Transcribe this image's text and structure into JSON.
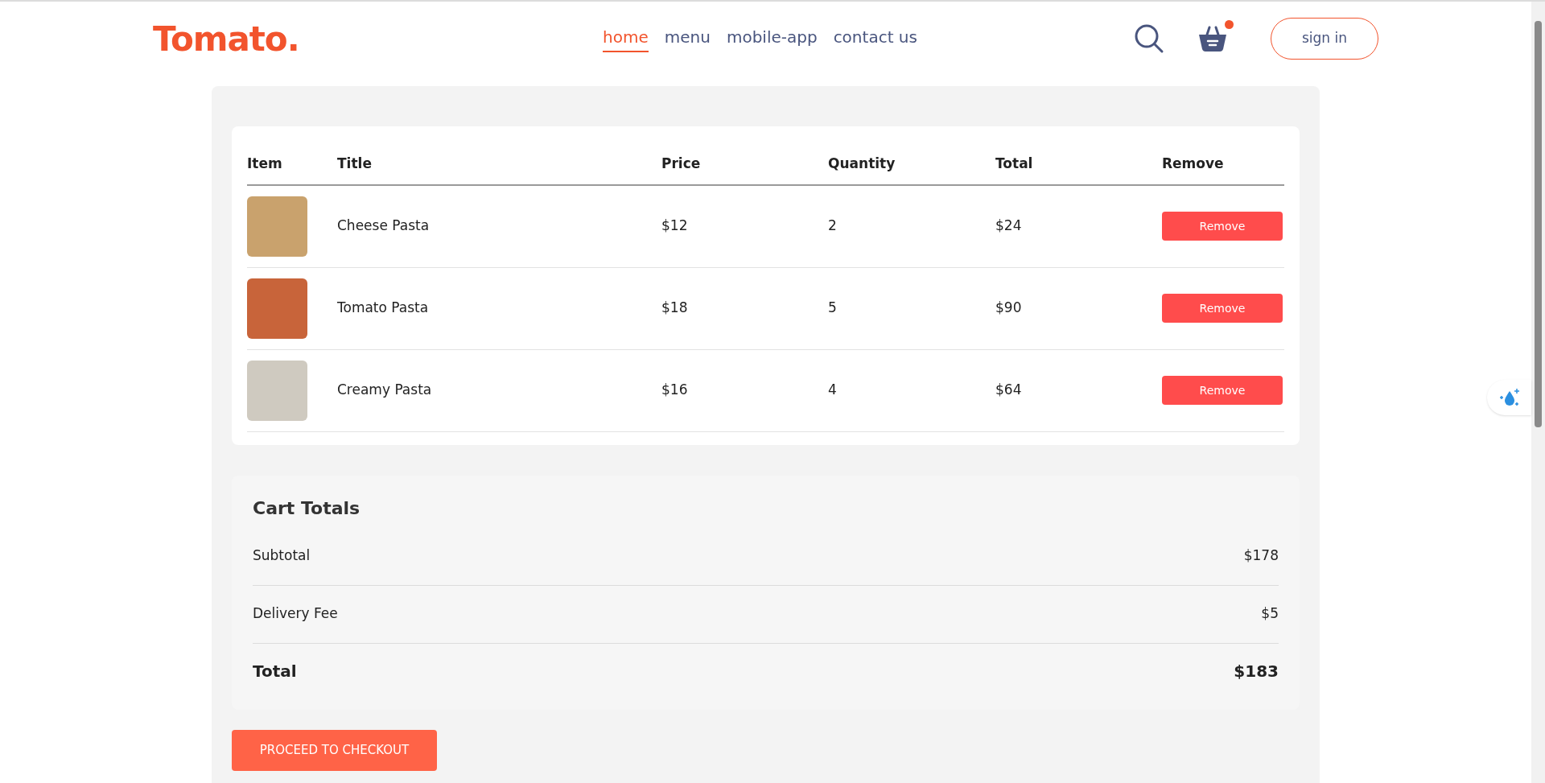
{
  "logo": "Tomato.",
  "nav": [
    {
      "label": "home",
      "selected": true
    },
    {
      "label": "menu",
      "selected": false
    },
    {
      "label": "mobile-app",
      "selected": false
    },
    {
      "label": "contact us",
      "selected": false
    }
  ],
  "cart": {
    "has_items": true
  },
  "sign_in": "sign in",
  "table": {
    "columns": [
      "Item",
      "Title",
      "Price",
      "Quantity",
      "Total",
      "Remove"
    ],
    "rows": [
      {
        "title": "Cheese Pasta",
        "price": "$12",
        "quantity": "2",
        "total": "$24",
        "remove": "Remove"
      },
      {
        "title": "Tomato Pasta",
        "price": "$18",
        "quantity": "5",
        "total": "$90",
        "remove": "Remove"
      },
      {
        "title": "Creamy Pasta",
        "price": "$16",
        "quantity": "4",
        "total": "$64",
        "remove": "Remove"
      }
    ]
  },
  "cart_totals": {
    "title": "Cart Totals",
    "lines": [
      {
        "label": "Subtotal",
        "value": "$178",
        "kind": "normal"
      },
      {
        "label": "Delivery Fee",
        "value": "$5",
        "kind": "normal"
      },
      {
        "label": "Total",
        "value": "$183",
        "kind": "total"
      }
    ]
  },
  "checkout": "PROCEED TO CHECKOUT"
}
